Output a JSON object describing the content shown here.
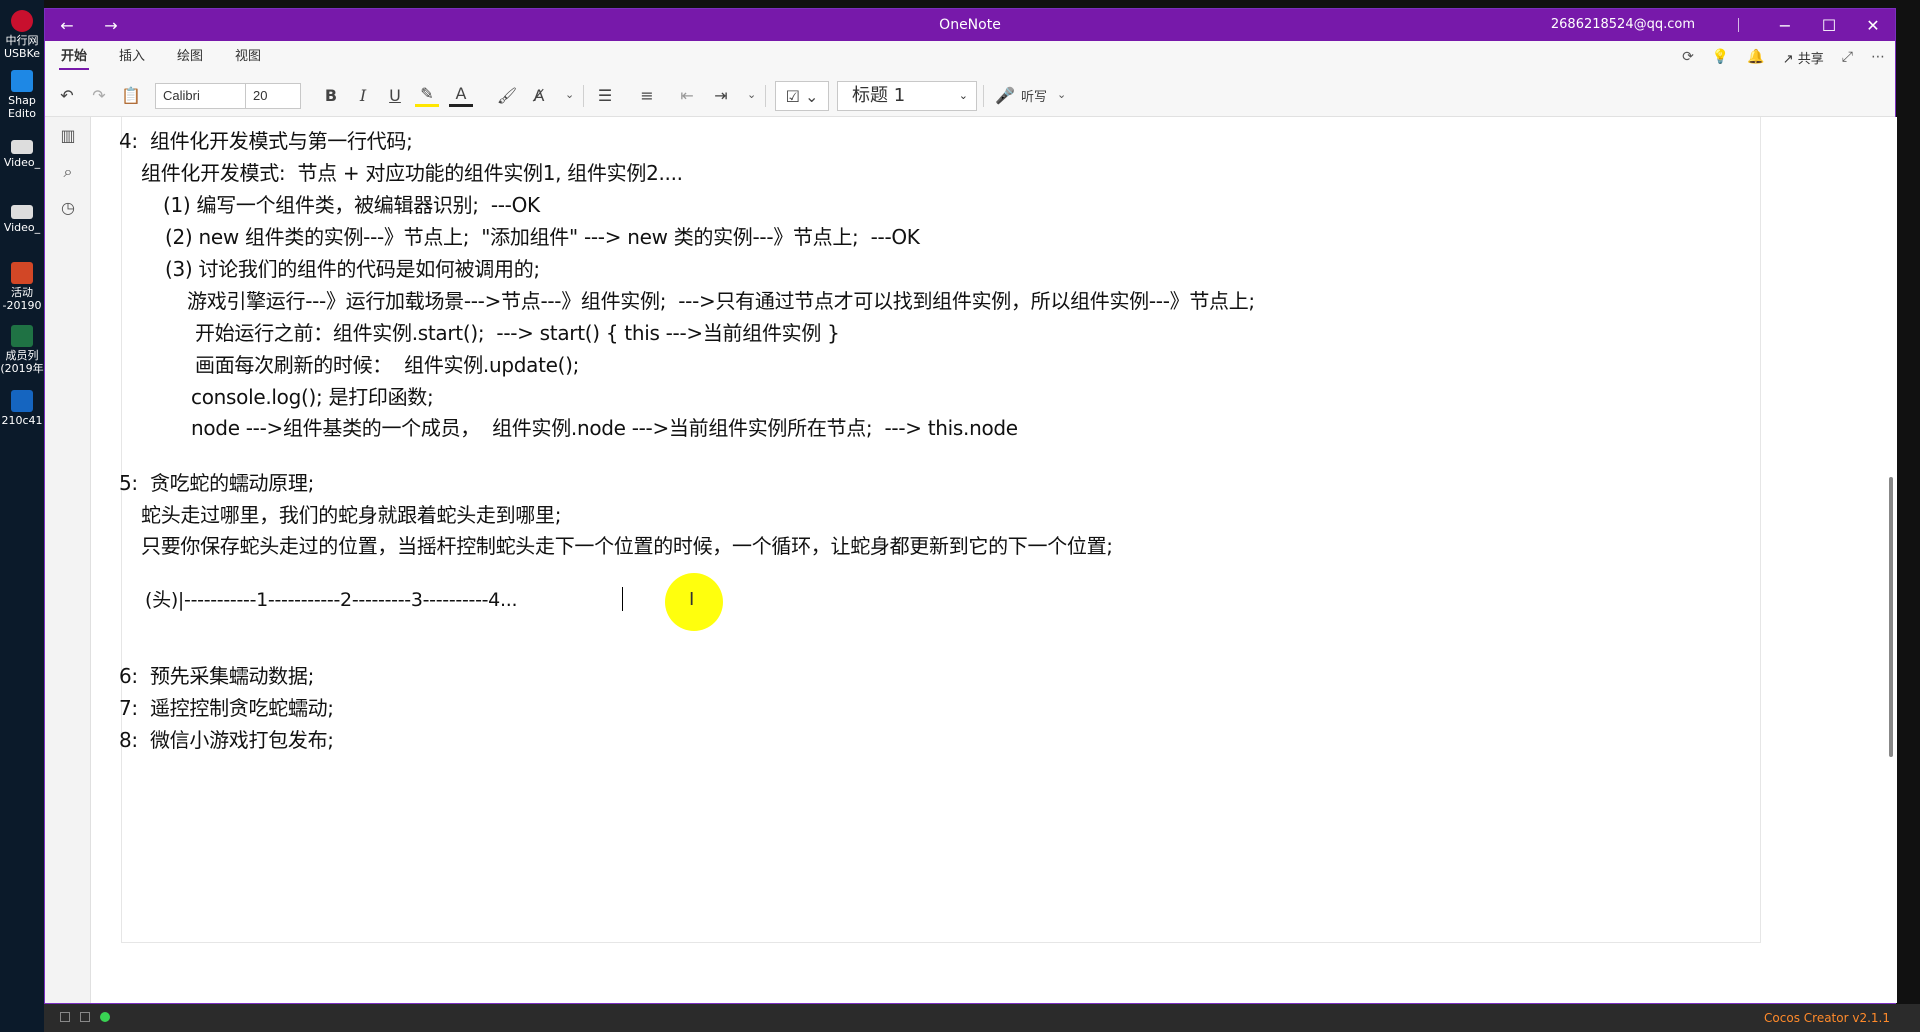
{
  "desktop": {
    "items": [
      {
        "label": "中行网\nUSBKe",
        "color": "#c8102e"
      },
      {
        "label": "Shap\nEdito",
        "color": "#1e88e5"
      },
      {
        "label": "Video_",
        "color": "#dddddd"
      },
      {
        "label": "Video_",
        "color": "#dddddd"
      },
      {
        "label": "活动\n-20190",
        "color": "#d24726"
      },
      {
        "label": "成员列\n(2019年",
        "color": "#1f7244"
      },
      {
        "label": "210c41",
        "color": "#1565c0"
      }
    ]
  },
  "window": {
    "title": "OneNote",
    "account": "2686218524@qq.com",
    "back_icon": "back-arrow-icon",
    "forward_icon": "forward-arrow-icon"
  },
  "tabs": [
    "开始",
    "插入",
    "绘图",
    "视图"
  ],
  "share_label": "共享",
  "toolbar": {
    "font_name": "Calibri",
    "font_size": "20",
    "bold": "B",
    "italic": "I",
    "underline": "U",
    "style": "标题 1",
    "dictate": "听写"
  },
  "content": {
    "lines": [
      "4:  组件化开发模式与第一行代码;",
      "组件化开发模式:  节点 + 对应功能的组件实例1, 组件实例2....",
      "(1) 编写一个组件类，被编辑器识别;  ---OK",
      "(2) new 组件类的实例---》节点上;  \"添加组件\" ---> new 类的实例---》节点上;  ---OK",
      "(3) 讨论我们的组件的代码是如何被调用的;",
      "游戏引擎运行---》运行加载场景--->节点---》组件实例;  --->只有通过节点才可以找到组件实例，所以组件实例---》节点上;",
      "开始运行之前：组件实例.start();  ---> start() { this --->当前组件实例 }",
      "画面每次刷新的时候：  组件实例.update();",
      "console.log(); 是打印函数;",
      "node --->组件基类的一个成员，  组件实例.node --->当前组件实例所在节点;  ---> this.node",
      "5:  贪吃蛇的蠕动原理;",
      "蛇头走过哪里，我们的蛇身就跟着蛇头走到哪里;",
      "只要你保存蛇头走过的位置，当摇杆控制蛇头走下一个位置的时候，一个循环，让蛇身都更新到它的下一个位置;",
      "(头)|-----------1-----------2---------3----------4...",
      "6:  预先采集蠕动数据;",
      "7:  遥控控制贪吃蛇蠕动;",
      "8:  微信小游戏打包发布;"
    ]
  },
  "statusbar": {
    "app": "Cocos Creator v2.1.1"
  },
  "colors": {
    "title_bar": "#7719aa",
    "highlight": "#ffff00"
  }
}
